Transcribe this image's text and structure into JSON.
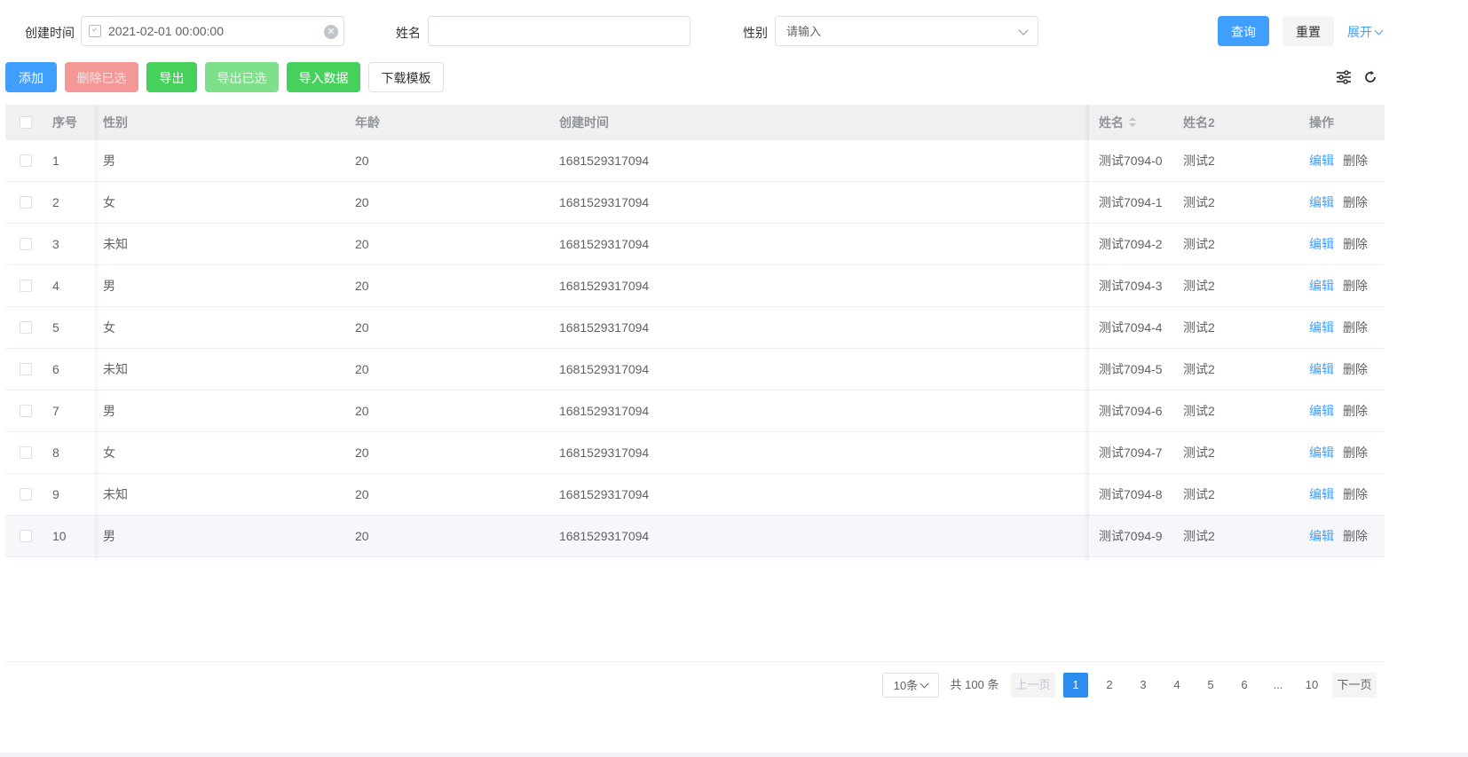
{
  "search": {
    "created_label": "创建时间",
    "created_value": "2021-02-01 00:00:00",
    "name_label": "姓名",
    "name_value": "",
    "gender_label": "性别",
    "gender_placeholder": "请输入",
    "query": "查询",
    "reset": "重置",
    "expand": "展开"
  },
  "toolbar": {
    "add": "添加",
    "delete_selected": "删除已选",
    "export": "导出",
    "export_selected": "导出已选",
    "import": "导入数据",
    "download_template": "下载模板"
  },
  "table": {
    "headers": {
      "index": "序号",
      "gender": "性别",
      "age": "年龄",
      "created": "创建时间",
      "name": "姓名",
      "name2": "姓名2",
      "actions": "操作"
    },
    "edit_label": "编辑",
    "delete_label": "删除",
    "rows": [
      {
        "index": "1",
        "gender": "男",
        "age": "20",
        "created": "1681529317094",
        "name": "测试7094-0",
        "name2": "测试2"
      },
      {
        "index": "2",
        "gender": "女",
        "age": "20",
        "created": "1681529317094",
        "name": "测试7094-1",
        "name2": "测试2"
      },
      {
        "index": "3",
        "gender": "未知",
        "age": "20",
        "created": "1681529317094",
        "name": "测试7094-2",
        "name2": "测试2"
      },
      {
        "index": "4",
        "gender": "男",
        "age": "20",
        "created": "1681529317094",
        "name": "测试7094-3",
        "name2": "测试2"
      },
      {
        "index": "5",
        "gender": "女",
        "age": "20",
        "created": "1681529317094",
        "name": "测试7094-4",
        "name2": "测试2"
      },
      {
        "index": "6",
        "gender": "未知",
        "age": "20",
        "created": "1681529317094",
        "name": "测试7094-5",
        "name2": "测试2"
      },
      {
        "index": "7",
        "gender": "男",
        "age": "20",
        "created": "1681529317094",
        "name": "测试7094-6",
        "name2": "测试2"
      },
      {
        "index": "8",
        "gender": "女",
        "age": "20",
        "created": "1681529317094",
        "name": "测试7094-7",
        "name2": "测试2"
      },
      {
        "index": "9",
        "gender": "未知",
        "age": "20",
        "created": "1681529317094",
        "name": "测试7094-8",
        "name2": "测试2"
      },
      {
        "index": "10",
        "gender": "男",
        "age": "20",
        "created": "1681529317094",
        "name": "测试7094-9",
        "name2": "测试2"
      }
    ]
  },
  "pagination": {
    "page_size": "10条",
    "total": "共 100 条",
    "prev": "上一页",
    "pages": [
      "1",
      "2",
      "3",
      "4",
      "5",
      "6",
      "...",
      "10"
    ],
    "current": "1",
    "next": "下一页"
  },
  "icons": {
    "settings": "sliders-icon",
    "refresh": "refresh-icon",
    "calendar": "calendar-icon",
    "clear": "clear-circle-icon"
  },
  "colors": {
    "primary": "#409eff",
    "success": "#48d05c",
    "danger_light": "#f39797",
    "active_page": "#2d8cf0"
  }
}
